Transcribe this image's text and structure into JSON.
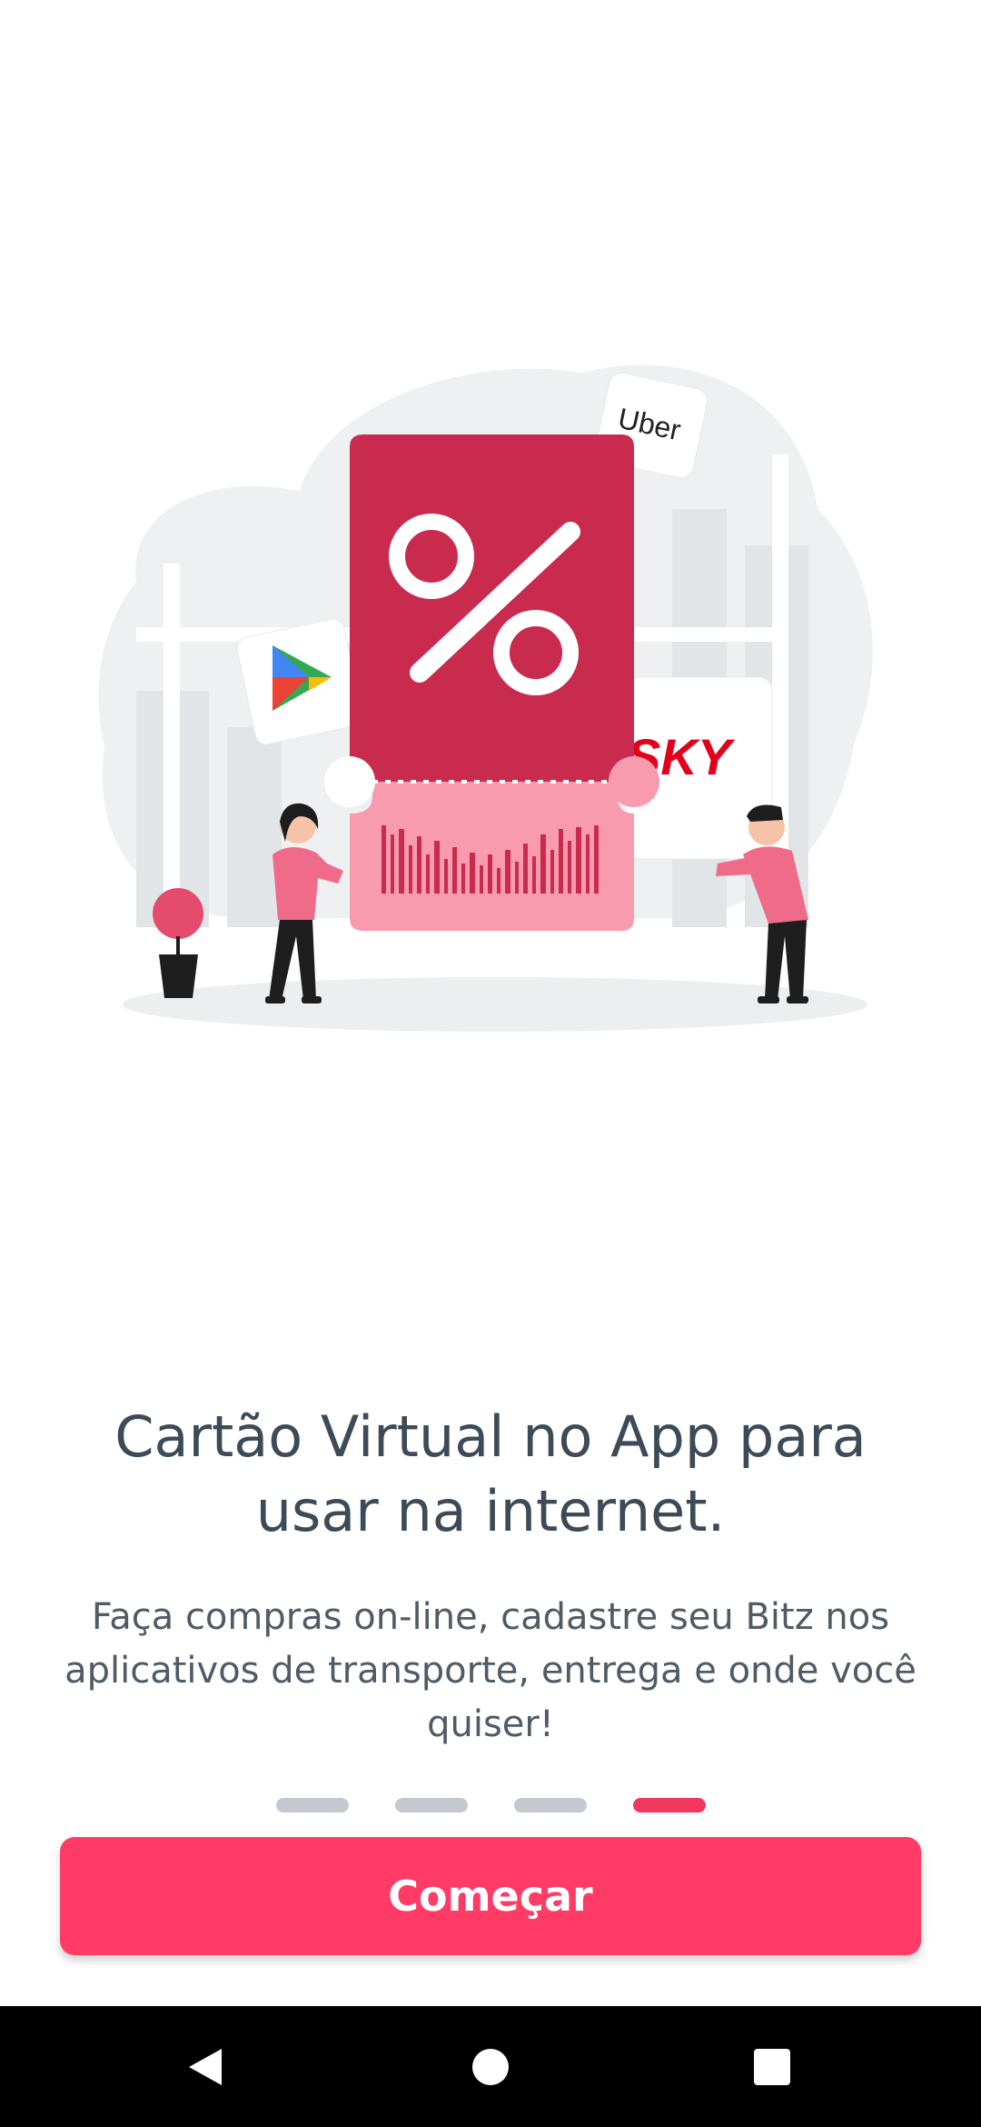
{
  "onboarding": {
    "title": "Cartão Virtual no App para usar na internet.",
    "description": "Faça compras on-line, cadastre seu Bitz nos aplicativos de transporte, entrega e onde você quiser!",
    "button_label": "Começar",
    "page_indicator": {
      "total": 4,
      "current": 4
    }
  },
  "illustration": {
    "logos": [
      "Uber",
      "Google Play",
      "SKY"
    ],
    "percent_symbol": "%"
  },
  "colors": {
    "accent": "#FF3B66",
    "indicator_active": "#F2375F",
    "indicator_inactive": "#C3C9CF",
    "title_text": "#3C4B57",
    "ticket_dark": "#C92B4E",
    "ticket_light": "#F99BAE"
  },
  "system_nav": {
    "icons": [
      "back-icon",
      "home-icon",
      "recents-icon"
    ]
  }
}
